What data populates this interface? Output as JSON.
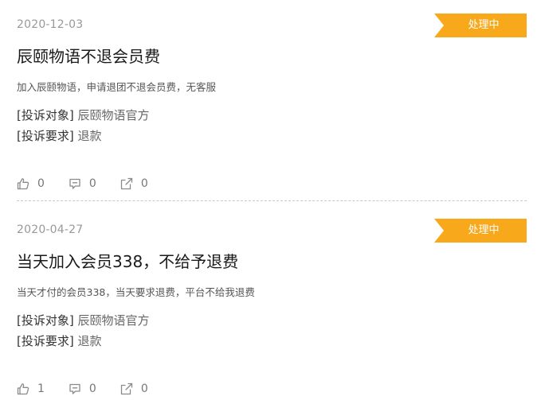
{
  "complaints": [
    {
      "date": "2020-12-03",
      "status": "处理中",
      "title": "辰颐物语不退会员费",
      "description": "加入辰颐物语，申请退团不退会员费，无客服",
      "target_label": "[投诉对象]",
      "target_value": "辰颐物语官方",
      "request_label": "[投诉要求]",
      "request_value": "退款",
      "likes": "0",
      "comments": "0",
      "shares": "0"
    },
    {
      "date": "2020-04-27",
      "status": "处理中",
      "title": "当天加入会员338，不给予退费",
      "description": "当天才付的会员338，当天要求退费，平台不给我退费",
      "target_label": "[投诉对象]",
      "target_value": "辰颐物语官方",
      "request_label": "[投诉要求]",
      "request_value": "退款",
      "likes": "1",
      "comments": "0",
      "shares": "0"
    }
  ],
  "icons": {
    "like": "thumbs-up-icon",
    "comment": "comment-icon",
    "share": "share-icon"
  },
  "colors": {
    "status_badge": "#f7a81b",
    "date": "#999999",
    "divider": "#c8c8c8"
  }
}
